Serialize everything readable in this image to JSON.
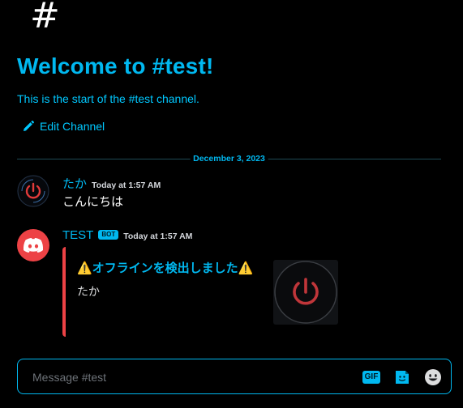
{
  "channel_header": {
    "icon": "hash-icon",
    "welcome_title": "Welcome to #test!",
    "welcome_subtitle": "This is the start of the #test channel.",
    "edit_channel_label": "Edit Channel"
  },
  "date_divider": {
    "label": "December 3, 2023"
  },
  "messages": [
    {
      "author": "たか",
      "timestamp": "Today at 1:57 AM",
      "avatar_icon": "power-icon",
      "content": "こんにちは"
    },
    {
      "author": "TEST",
      "bot_tag": "BOT",
      "timestamp": "Today at 1:57 AM",
      "avatar_icon": "discord-logo-icon",
      "embed": {
        "title": "⚠️オフラインを検出しました⚠️",
        "description": "たか",
        "accent_color": "#ed4245",
        "thumbnail_icon": "power-icon"
      }
    }
  ],
  "composer": {
    "placeholder": "Message #test",
    "value": "",
    "gif_label": "GIF",
    "sticker_icon": "sticker-icon",
    "emoji_icon": "emoji-icon"
  },
  "colors": {
    "background": "#000000",
    "accent": "#00b8f0",
    "danger": "#ed4245"
  }
}
